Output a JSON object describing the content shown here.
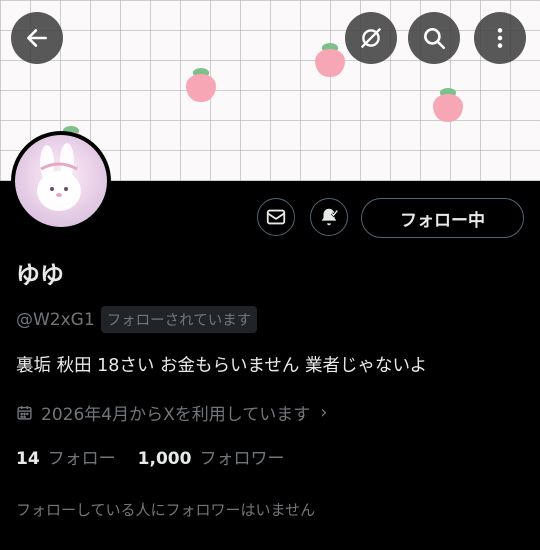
{
  "header": {
    "back_icon": "arrow-left-icon",
    "grok_icon": "grok-icon",
    "search_icon": "search-icon",
    "more_icon": "more-vertical-icon"
  },
  "profile": {
    "display_name": "ゆゆ",
    "handle": "@W2xG1",
    "follows_you_badge": "フォローされています",
    "bio": "裏垢 秋田 18さい お金もらいません 業者じゃないよ",
    "joined": "2026年4月からXを利用しています",
    "following_count": "14",
    "following_label": "フォロー",
    "followers_count": "1,000",
    "followers_label": "フォロワー",
    "mutual_note": "フォローしている人にフォロワーはいません"
  },
  "actions": {
    "message_icon": "envelope-icon",
    "notify_icon": "bell-check-icon",
    "follow_button_label": "フォロー中"
  },
  "colors": {
    "background": "#000000",
    "text": "#e7e9ea",
    "muted": "#71767b",
    "border": "#536471"
  }
}
